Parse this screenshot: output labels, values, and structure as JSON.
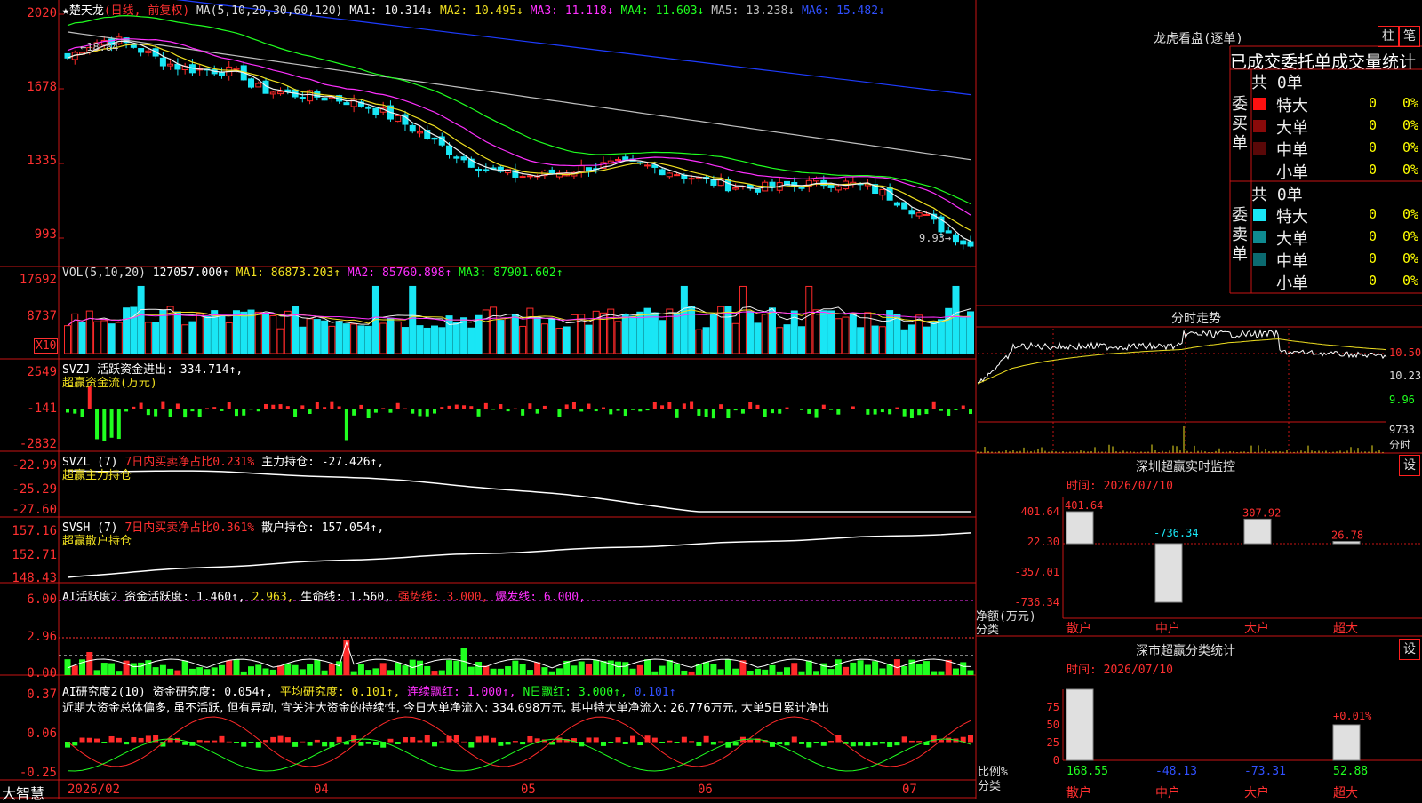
{
  "stock": {
    "name": "楚天龙",
    "period": "(日线, 前复权)"
  },
  "colors": {
    "up": "#ff2a2a",
    "down": "#19e6f5",
    "ma5": "#f0f0f0",
    "ma10": "#f0e020",
    "ma20": "#ff30ff",
    "ma30": "#20ff20",
    "ma60": "#c0c0c0",
    "ma120": "#1e3cff",
    "frame": "#c81414"
  },
  "price_panel": {
    "ma_label": "MA(5,10,20,30,60,120)",
    "ma1": "MA1: 10.314↓",
    "ma2": "MA2: 10.495↓",
    "ma3": "MA3: 11.118↓",
    "ma4": "MA4: 11.603↓",
    "ma5": "MA5: 13.238↓",
    "ma6": "MA6: 15.482↓",
    "y_labels": [
      "2020",
      "1678",
      "1335",
      "993"
    ],
    "high_label": "18.84",
    "low_label": "9.93"
  },
  "vol_panel": {
    "label": "VOL(5,10,20)",
    "value": "127057.000↑",
    "ma1": "MA1: 86873.203↑",
    "ma2": "MA2: 85760.898↑",
    "ma3": "MA3: 87901.602↑",
    "y_labels": [
      "17692",
      "8737"
    ],
    "unit": "X10"
  },
  "svzj_panel": {
    "label": "SVZJ  活跃资金进出: 334.714↑,",
    "sub": "超赢资金流(万元)",
    "y_labels": [
      "2549",
      "-141",
      "-2832"
    ]
  },
  "svzl_panel": {
    "label": "SVZL (7)",
    "net": "7日内买卖净占比0.231%",
    "hold": "主力持仓: -27.426↑,",
    "sub": "超赢主力持仓",
    "y_labels": [
      "-22.99",
      "-25.29",
      "-27.60"
    ]
  },
  "svsh_panel": {
    "label": "SVSH (7)",
    "net": "7日内买卖净占比0.361%",
    "hold": "散户持仓: 157.054↑,",
    "sub": "超赢散户持仓",
    "y_labels": [
      "157.16",
      "152.71",
      "148.43"
    ]
  },
  "ai_active_panel": {
    "label": "AI活跃度2 资金活跃度: 1.460↑,",
    "v2": "2.963,",
    "life": "生命线: 1.560,",
    "strong": "强势线: 3.000,",
    "burst": "爆发线: 6.000,",
    "y_labels": [
      "6.00",
      "2.96",
      "0.00"
    ]
  },
  "ai_research_panel": {
    "label": "AI研究度2(10) 资金研究度: 0.054↑,",
    "avg": "平均研究度: 0.101↑,",
    "red": "连续飘红: 1.000↑,",
    "nred": "N日飘红: 3.000↑,",
    "last": "0.101↑",
    "comment": "近期大资金总体偏多, 虽不活跃, 但有异动, 宜关注大资金的持续性, 今日大单净流入: 334.698万元, 其中特大单净流入: 26.776万元, 大单5日累计净出",
    "y_labels": [
      "0.37",
      "0.06",
      "-0.25"
    ]
  },
  "bottom_bar": {
    "brand": "大智慧",
    "dates": [
      "2026/02",
      "04",
      "05",
      "06",
      "07"
    ]
  },
  "right_panel": {
    "title": "龙虎看盘(逐单)",
    "btn1": "柱",
    "btn2": "笔",
    "dragon_header": "已成交委托单成交量统计",
    "buy_label": "委买单",
    "sell_label": "委卖单",
    "buy_total": "共 0单",
    "sell_total": "共 0单",
    "buy_rows": [
      {
        "name": "特大",
        "count": "0",
        "pct": "0%"
      },
      {
        "name": "大单",
        "count": "0",
        "pct": "0%"
      },
      {
        "name": "中单",
        "count": "0",
        "pct": "0%"
      },
      {
        "name": "小单",
        "count": "0",
        "pct": "0%"
      }
    ],
    "sell_rows": [
      {
        "name": "特大",
        "count": "0",
        "pct": "0%"
      },
      {
        "name": "大单",
        "count": "0",
        "pct": "0%"
      },
      {
        "name": "中单",
        "count": "0",
        "pct": "0%"
      },
      {
        "name": "小单",
        "count": "0",
        "pct": "0%"
      }
    ],
    "minute_title": "分时走势",
    "minute_y": [
      "10.50",
      "10.23",
      "9.96",
      "9733"
    ],
    "minute_unit": "分时",
    "monitor_title": "深圳超赢实时监控",
    "monitor_btn": "设",
    "monitor_time": "时间: 2026/07/10",
    "monitor_y": [
      "401.64",
      "22.30",
      "-357.01",
      "-736.34"
    ],
    "monitor_values": [
      "401.64",
      "-736.34",
      "307.92",
      "26.78"
    ],
    "monitor_axis": [
      "净额(万元)",
      "分类"
    ],
    "categories": [
      "散户",
      "中户",
      "大户",
      "超大"
    ],
    "stats_title": "深市超赢分类统计",
    "stats_btn": "设",
    "stats_time": "时间: 2026/07/10",
    "stats_y": [
      "75",
      "50",
      "25",
      "0"
    ],
    "stats_top": "+0.01%",
    "stats_values": [
      "168.55",
      "-48.13",
      "-73.31",
      "52.88"
    ],
    "stats_axis": [
      "比例%",
      "分类"
    ]
  }
}
